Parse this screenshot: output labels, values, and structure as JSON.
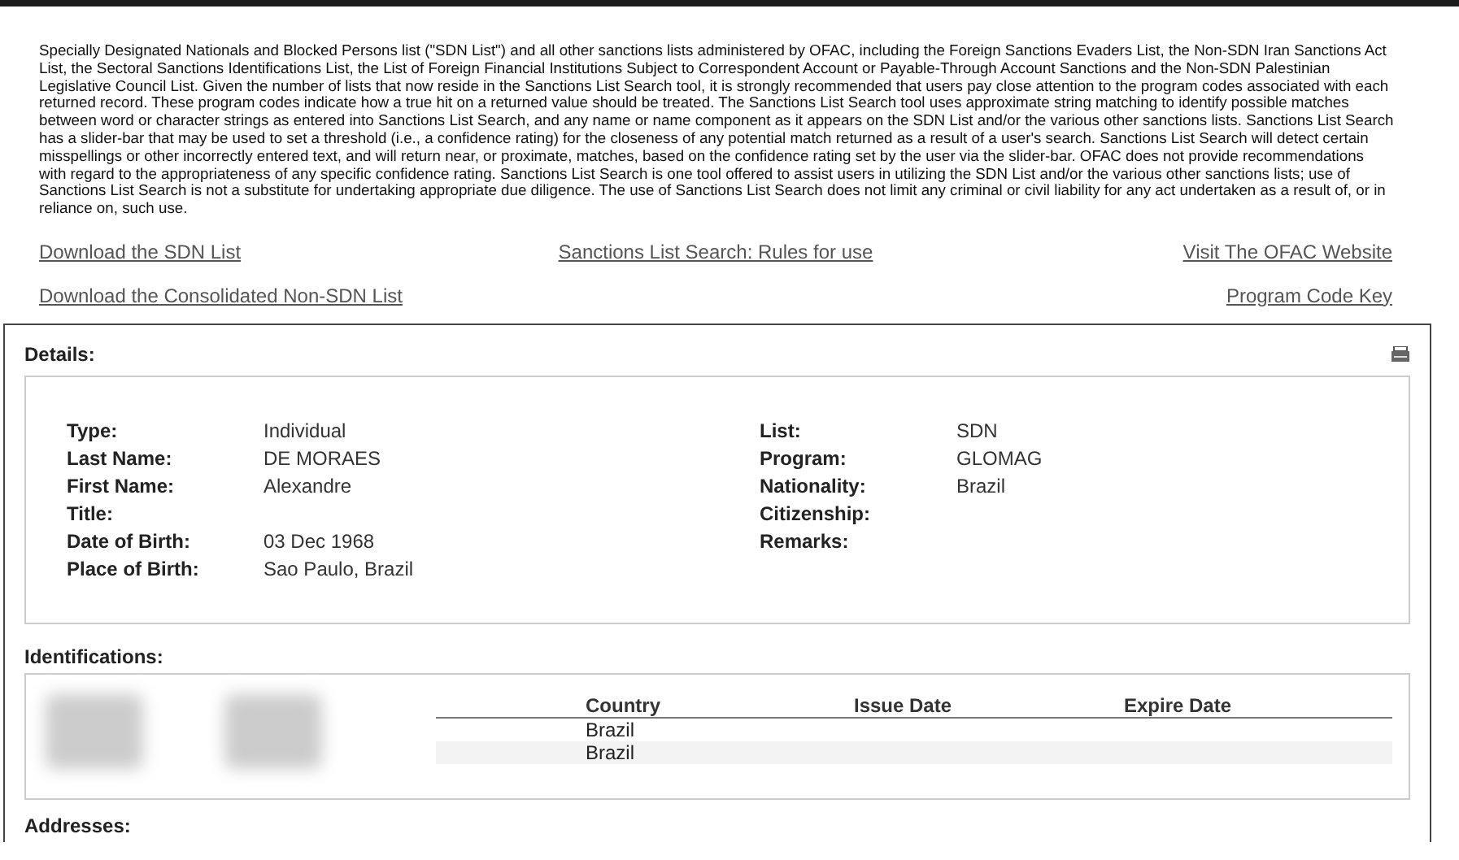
{
  "disclaimer": "Specially Designated Nationals and Blocked Persons list (\"SDN List\") and all other sanctions lists administered by OFAC, including the Foreign Sanctions Evaders List, the Non-SDN Iran Sanctions Act List, the Sectoral Sanctions Identifications List, the List of Foreign Financial Institutions Subject to Correspondent Account or Payable-Through Account Sanctions and the Non-SDN Palestinian Legislative Council List. Given the number of lists that now reside in the Sanctions List Search tool, it is strongly recommended that users pay close attention to the program codes associated with each returned record. These program codes indicate how a true hit on a returned value should be treated. The Sanctions List Search tool uses approximate string matching to identify possible matches between word or character strings as entered into Sanctions List Search, and any name or name component as it appears on the SDN List and/or the various other sanctions lists. Sanctions List Search has a slider-bar that may be used to set a threshold (i.e., a confidence rating) for the closeness of any potential match returned as a result of a user's search. Sanctions List Search will detect certain misspellings or other incorrectly entered text, and will return near, or proximate, matches, based on the confidence rating set by the user via the slider-bar. OFAC does not provide recommendations with regard to the appropriateness of any specific confidence rating. Sanctions List Search is one tool offered to assist users in utilizing the SDN List and/or the various other sanctions lists; use of Sanctions List Search is not a substitute for undertaking appropriate due diligence. The use of Sanctions List Search does not limit any criminal or civil liability for any act undertaken as a result of, or in reliance on, such use.",
  "links": [
    {
      "left": "Download the SDN List",
      "center": "Sanctions List Search: Rules for use",
      "right": "Visit The OFAC Website"
    },
    {
      "left": "Download the Consolidated Non-SDN List",
      "right": "Program Code Key"
    }
  ],
  "details": {
    "title": "Details:",
    "left": [
      {
        "label": "Type:",
        "value": "Individual"
      },
      {
        "label": "Last Name:",
        "value": "DE MORAES"
      },
      {
        "label": "First Name:",
        "value": "Alexandre"
      },
      {
        "label": "Title:"
      },
      {
        "label": "Date of Birth:",
        "value": "03 Dec 1968"
      },
      {
        "label": "Place of Birth:",
        "value": "Sao Paulo, Brazil"
      }
    ],
    "right": [
      {
        "label": "List:",
        "value": "SDN"
      },
      {
        "label": "Program:",
        "value": "GLOMAG"
      },
      {
        "label": "Nationality:",
        "value": "Brazil"
      },
      {
        "label": "Citizenship:"
      },
      {
        "label": "Remarks:"
      }
    ]
  },
  "identifications": {
    "title": "Identifications:",
    "columns": [
      "Country",
      "Issue Date",
      "Expire Date"
    ],
    "rows": [
      {
        "country": "Brazil"
      },
      {
        "country": "Brazil"
      }
    ]
  },
  "addresses": {
    "title": "Addresses:"
  }
}
